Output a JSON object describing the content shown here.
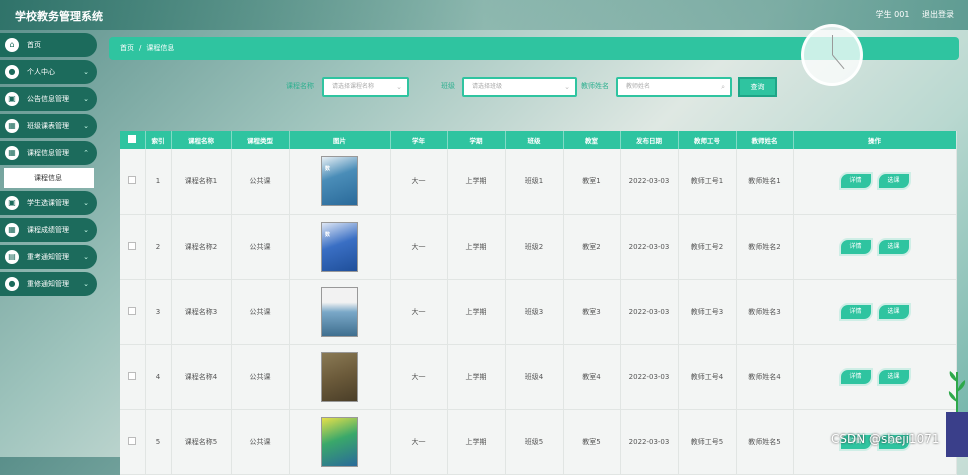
{
  "app": {
    "title": "学校教务管理系统"
  },
  "header": {
    "user": "学生 001",
    "logout": "退出登录"
  },
  "sidebar": {
    "items": [
      {
        "label": "首页",
        "icon": "home-icon",
        "chev": false
      },
      {
        "label": "个人中心",
        "icon": "user-icon",
        "chev": true
      },
      {
        "label": "公告信息管理",
        "icon": "briefcase-icon",
        "chev": true
      },
      {
        "label": "班级课表管理",
        "icon": "grid-icon",
        "chev": true
      },
      {
        "label": "课程信息管理",
        "icon": "grid-icon",
        "chev": true
      }
    ],
    "sub_item": "课程信息",
    "items_after": [
      {
        "label": "学生选课管理",
        "icon": "briefcase-icon"
      },
      {
        "label": "课程成绩管理",
        "icon": "grid-icon"
      },
      {
        "label": "重考通知管理",
        "icon": "card-icon"
      },
      {
        "label": "重修通知管理",
        "icon": "user-icon"
      }
    ]
  },
  "breadcrumb": {
    "home": "首页",
    "sep": "/",
    "current": "课程信息"
  },
  "search": {
    "course_label": "课程名称",
    "course_placeholder": "请选择课程名称",
    "class_label": "班级",
    "class_placeholder": "请选择班级",
    "teacher_label": "教师姓名",
    "teacher_placeholder": "教师姓名",
    "query_button": "查询"
  },
  "table": {
    "headers": [
      "",
      "索引",
      "课程名称",
      "课程类型",
      "图片",
      "学年",
      "学期",
      "班级",
      "教室",
      "发布日期",
      "教师工号",
      "教师姓名",
      "操作"
    ],
    "rows": [
      {
        "index": "1",
        "name": "课程名称1",
        "type": "公共课",
        "year": "大一",
        "term": "上学期",
        "class": "班级1",
        "room": "教室1",
        "date": "2022-03-03",
        "tid": "教师工号1",
        "tname": "教师姓名1",
        "cover": "#4a8db8"
      },
      {
        "index": "2",
        "name": "课程名称2",
        "type": "公共课",
        "year": "大一",
        "term": "上学期",
        "class": "班级2",
        "room": "教室2",
        "date": "2022-03-03",
        "tid": "教师工号2",
        "tname": "教师姓名2",
        "cover": "#3a6fc4"
      },
      {
        "index": "3",
        "name": "课程名称3",
        "type": "公共课",
        "year": "大一",
        "term": "上学期",
        "class": "班级3",
        "room": "教室3",
        "date": "2022-03-03",
        "tid": "教师工号3",
        "tname": "教师姓名3",
        "cover": "#5a8aa8"
      },
      {
        "index": "4",
        "name": "课程名称4",
        "type": "公共课",
        "year": "大一",
        "term": "上学期",
        "class": "班级4",
        "room": "教室4",
        "date": "2022-03-03",
        "tid": "教师工号4",
        "tname": "教师姓名4",
        "cover": "#6b5a3a"
      },
      {
        "index": "5",
        "name": "课程名称5",
        "type": "公共课",
        "year": "大一",
        "term": "上学期",
        "class": "班级5",
        "room": "教室5",
        "date": "2022-03-03",
        "tid": "教师工号5",
        "tname": "教师姓名5",
        "cover": "#3aa86a"
      }
    ],
    "detail_button": "详情",
    "select_button": "选课"
  },
  "watermark": "CSDN @sheji1071",
  "colors": {
    "accent": "#2fc4a0",
    "sidebar": "#1c6b5c"
  }
}
